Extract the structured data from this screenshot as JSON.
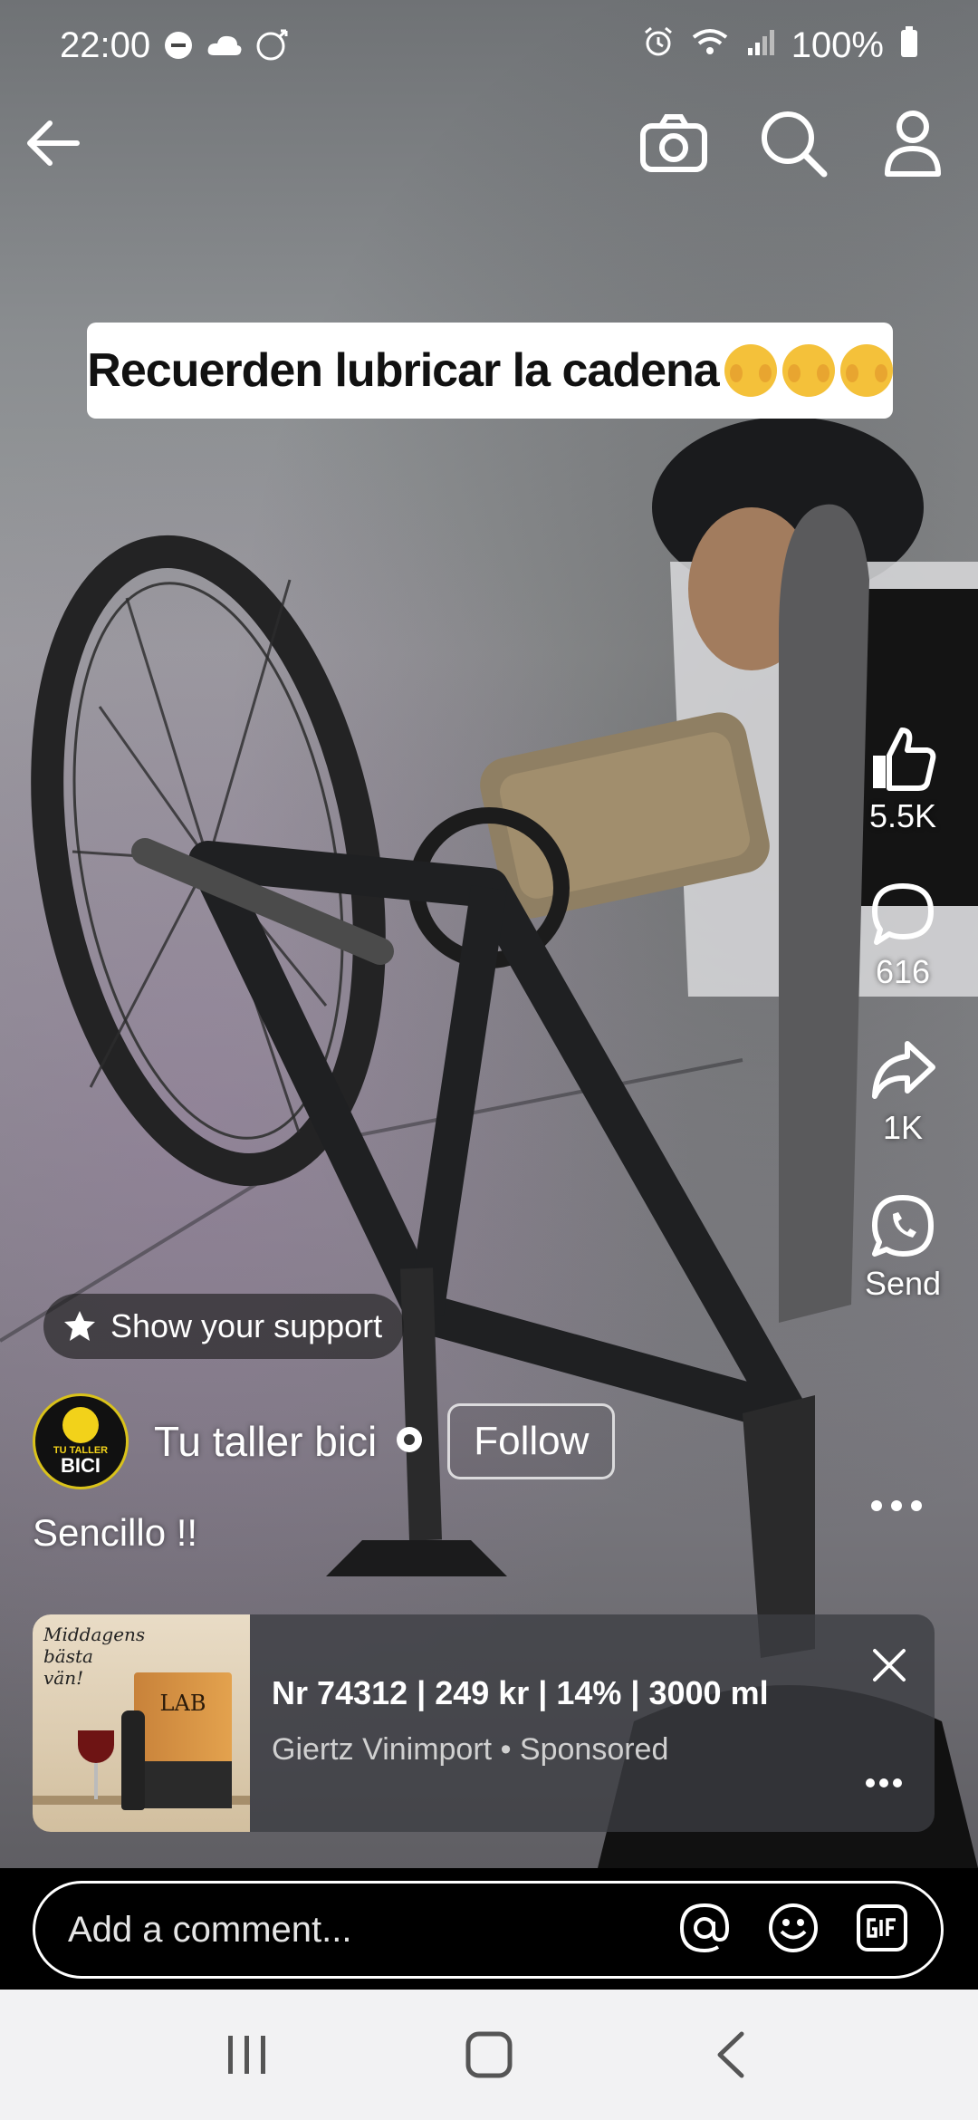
{
  "status_bar": {
    "time": "22:00",
    "battery": "100%",
    "icons": [
      "do-not-disturb-icon",
      "cloud-icon",
      "volvo-icon",
      "alarm-icon",
      "wifi-icon",
      "signal-icon",
      "battery-icon"
    ]
  },
  "top_bar": {
    "icons": [
      "back-arrow-icon",
      "camera-icon",
      "search-icon",
      "profile-icon"
    ]
  },
  "video": {
    "caption": "Recuerden lubricar la cadena"
  },
  "actions": {
    "like_count": "5.5K",
    "comment_count": "616",
    "share_count": "1K",
    "send_label": "Send"
  },
  "support": {
    "label": "Show your support"
  },
  "author": {
    "name": "Tu taller bici",
    "avatar_text_top": "TU TALLER",
    "avatar_text_bottom": "BICI",
    "follow_label": "Follow",
    "description": "Sencillo !!"
  },
  "ad": {
    "thumb_text": "Middagens bästa vän!",
    "thumb_box_text": "LAB",
    "title": "Nr 74312 | 249 kr | 14% | 3000 ml",
    "advertiser": "Giertz Vinimport",
    "sponsored": "Sponsored",
    "separator": " • "
  },
  "comment": {
    "placeholder": "Add a comment..."
  },
  "nav": {
    "icons": [
      "recents-icon",
      "home-icon",
      "back-icon"
    ]
  },
  "colors": {
    "ad_background": "#3c3e42",
    "nav_background": "#f2f2f3",
    "avatar_accent": "#f2d21a"
  }
}
